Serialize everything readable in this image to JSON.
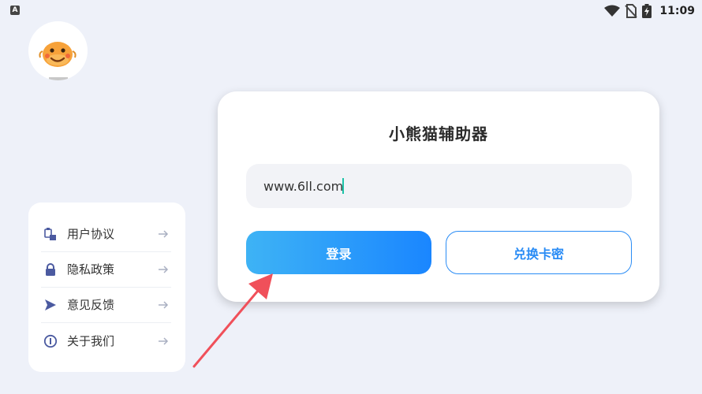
{
  "status_bar": {
    "left_icon_letter": "A",
    "icons": [
      "wifi-icon",
      "no-sim-icon",
      "battery-charging-icon"
    ],
    "time": "11:09"
  },
  "menu": {
    "items": [
      {
        "label": "用户协议",
        "icon": "document-icon"
      },
      {
        "label": "隐私政策",
        "icon": "lock-icon"
      },
      {
        "label": "意见反馈",
        "icon": "send-icon"
      },
      {
        "label": "关于我们",
        "icon": "info-icon"
      }
    ]
  },
  "login": {
    "title": "小熊猫辅助器",
    "input_value": "www.6ll.com",
    "login_button": "登录",
    "redeem_button": "兑换卡密"
  },
  "colors": {
    "background": "#eef1f9",
    "accent": "#1a86ff",
    "arrow": "#f0505a"
  }
}
